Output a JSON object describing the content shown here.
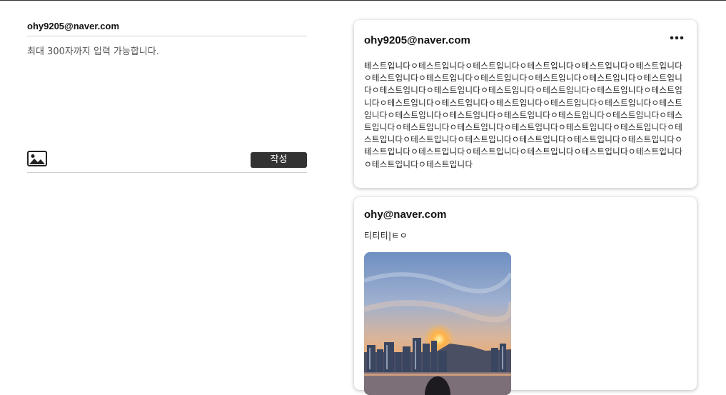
{
  "composer": {
    "user_email": "ohy9205@naver.com",
    "placeholder": "최대 300자까지 입력 가능합니다.",
    "image_icon": "image-icon",
    "submit_label": "작성"
  },
  "feed": {
    "posts": [
      {
        "user_email": "ohy9205@naver.com",
        "menu_icon": "more-horizontal-icon",
        "body": "테스트입니다ㅇ테스트입니다ㅇ테스트입니다ㅇ테스트입니다ㅇ테스트입니다ㅇ테스트입니다ㅇ테스트입니다ㅇ테스트입니다ㅇ테스트입니다ㅇ테스트입니다ㅇ테스트입니다ㅇ테스트입니다ㅇ테스트입니다ㅇ테스트입니다ㅇ테스트입니다ㅇ테스트입니다ㅇ테스트입니다ㅇ테스트입니다ㅇ테스트입니다ㅇ테스트입니다ㅇ테스트입니다ㅇ테스트입니다ㅇ테스트입니다ㅇ테스트입니다ㅇ테스트입니다ㅇ테스트입니다ㅇ테스트입니다ㅇ테스트입니다ㅇ테스트입니다ㅇ테스트입니다ㅇ테스트입니다ㅇ테스트입니다ㅇ테스트입니다ㅇ테스트입니다ㅇ테스트입니다ㅇ테스트입니다ㅇ테스트입니다ㅇ테스트입니다ㅇ테스트입니다ㅇ테스트입니다ㅇ테스트입니다ㅇ테스트입니다ㅇ테스트입니다ㅇ테스트입니다ㅇ테스트입니다ㅇ테스트입니다ㅇ테스트입니다ㅇ테스트입니다ㅇ테스트입니다"
      },
      {
        "user_email": "ohy@naver.com",
        "body": "티티티|ㅌㅇ",
        "photo": "sunset-city-photo"
      }
    ]
  },
  "colors": {
    "button_bg": "#333333",
    "button_text": "#ffffff",
    "divider": "#cfcfcf"
  }
}
